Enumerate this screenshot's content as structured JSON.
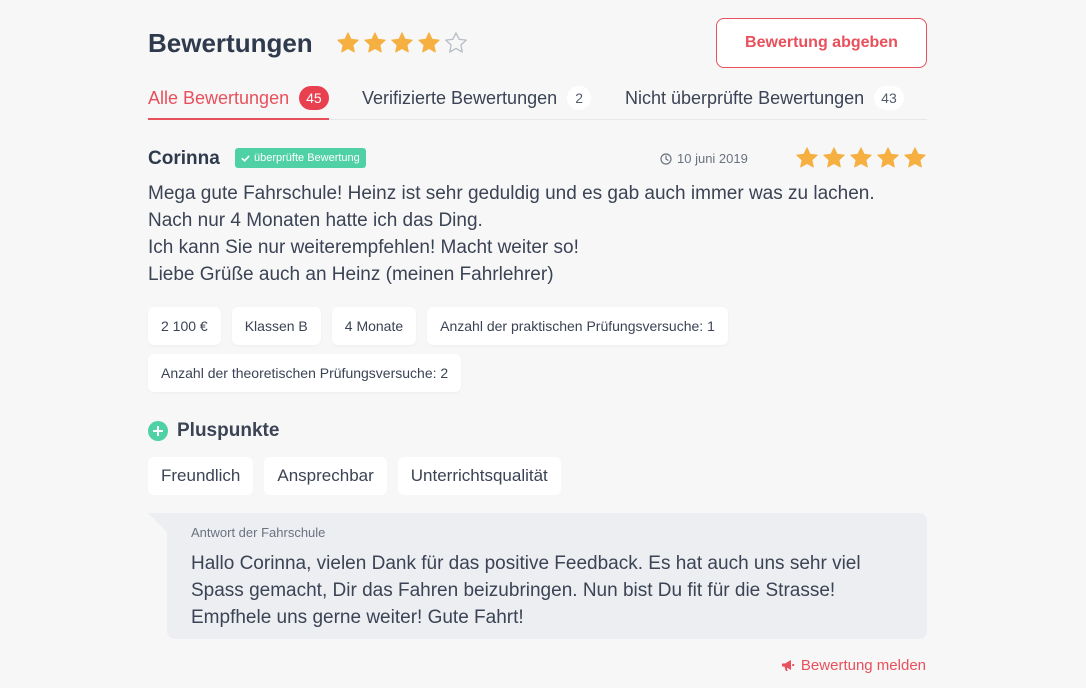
{
  "header": {
    "title": "Bewertungen",
    "rating": 4,
    "max_rating": 5,
    "give_review_label": "Bewertung abgeben"
  },
  "tabs": [
    {
      "label": "Alle Bewertungen",
      "count": "45",
      "active": true
    },
    {
      "label": "Verifizierte Bewertungen",
      "count": "2",
      "active": false
    },
    {
      "label": "Nicht überprüfte Bewertungen",
      "count": "43",
      "active": false
    }
  ],
  "review": {
    "author": "Corinna",
    "badge": "überprüfte Bewertung",
    "date": "10 juni 2019",
    "rating": 5,
    "text_lines": [
      "Mega gute Fahrschule! Heinz ist sehr geduldig und es gab auch immer was zu lachen.",
      "Nach nur 4 Monaten hatte ich das Ding.",
      "Ich kann Sie nur weiterempfehlen! Macht weiter so!",
      "Liebe Grüße auch an Heinz (meinen Fahrlehrer)"
    ],
    "details": [
      "2 100 €",
      "Klassen B",
      "4 Monate",
      "Anzahl der praktischen Prüfungsversuche: 1",
      "Anzahl der theoretischen Prüfungsversuche: 2"
    ],
    "pros_title": "Pluspunkte",
    "pros": [
      "Freundlich",
      "Ansprechbar",
      "Unterrichtsqualität"
    ]
  },
  "answer": {
    "label": "Antwort der Fahrschule",
    "text": "Hallo Corinna, vielen Dank für das positive Feedback. Es hat auch uns sehr viel Spass gemacht, Dir das Fahren beizubringen. Nun bist Du fit für die Strasse! Empfhele uns gerne weiter! Gute Fahrt!"
  },
  "report_label": "Bewertung melden",
  "colors": {
    "accent": "#e8505b",
    "star": "#f5b041",
    "verified": "#4fd1a5",
    "text": "#3b4354"
  },
  "icons": {
    "star": "star-icon",
    "clock": "clock-icon",
    "check": "check-icon",
    "plus": "plus-circle-icon",
    "megaphone": "megaphone-icon"
  }
}
